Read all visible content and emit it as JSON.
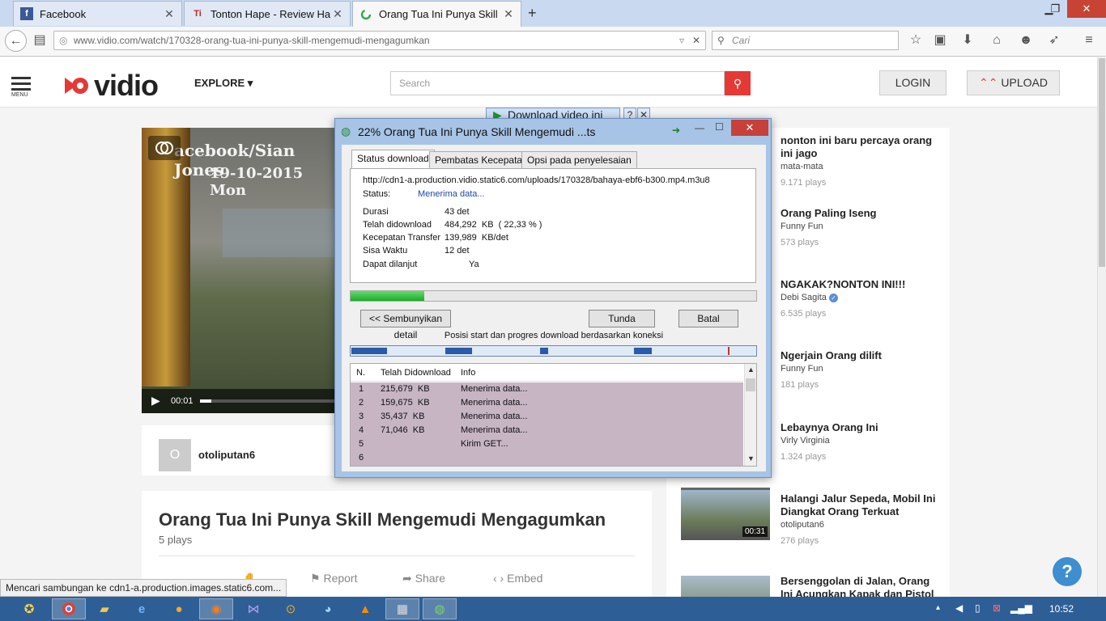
{
  "browser": {
    "tabs": [
      {
        "label": "Facebook",
        "icon": "facebook-icon"
      },
      {
        "label": "Tonton Hape - Review Han...",
        "icon": "tontonhape-icon"
      },
      {
        "label": "Orang Tua Ini Punya Skill ...",
        "icon": "loading-icon"
      }
    ],
    "url": "www.vidio.com/watch/170328-orang-tua-ini-punya-skill-mengemudi-mengagumkan",
    "search_placeholder": "Cari",
    "status_message": "Mencari sambungan ke cdn1-a.production.images.static6.com..."
  },
  "site": {
    "menu_label": "MENU",
    "logo": "vidio",
    "explore": "EXPLORE",
    "search_placeholder": "Search",
    "login": "LOGIN",
    "upload": "UPLOAD",
    "accent": "#e53935"
  },
  "video": {
    "overlay_line1": "acebook/Sian Jones",
    "overlay_line2": "19-10-2015 Mon",
    "time": "00:01",
    "uploader_initial": "O",
    "uploader": "otoliputan6",
    "title": "Orang Tua Ini Punya Skill Mengemudi Mengagumkan",
    "plays": "5 plays",
    "actions": {
      "report": "Report",
      "share": "Share",
      "embed": "Embed"
    }
  },
  "sidebar": [
    {
      "title": "nonton ini baru percaya orang ini jago",
      "channel": "mata-mata",
      "plays": "9.171 plays"
    },
    {
      "title": "Orang Paling Iseng",
      "channel": "Funny Fun",
      "plays": "573 plays"
    },
    {
      "title": "NGAKAK?NONTON INI!!!",
      "channel": "Debi Sagita",
      "plays": "6.535 plays"
    },
    {
      "title": "Ngerjain Orang dilift",
      "channel": "Funny Fun",
      "plays": "181 plays"
    },
    {
      "title": "Lebaynya Orang Ini",
      "channel": "Virly Virginia",
      "plays": "1.324 plays"
    },
    {
      "title": "Halangi Jalur Sepeda, Mobil Ini Diangkat Orang Terkuat",
      "channel": "otoliputan6",
      "plays": "276 plays",
      "duration": "00:31"
    },
    {
      "title": "Bersenggolan di Jalan, Orang Ini Acungkan Kapak dan Pistol",
      "channel": "",
      "plays": ""
    }
  ],
  "download_button": "Download video ini",
  "dialog": {
    "title": "22% Orang Tua Ini Punya Skill Mengemudi ...ts",
    "tabs": [
      "Status download",
      "Pembatas Kecepatan",
      "Opsi pada penyelesaian"
    ],
    "url": "http://cdn1-a.production.vidio.static6.com/uploads/170328/bahaya-ebf6-b300.mp4.m3u8",
    "status_label": "Status:",
    "status_value": "Menerima data...",
    "fields": [
      {
        "label": "Durasi",
        "value": "43 det"
      },
      {
        "label": "Telah didownload",
        "value": "484,292  KB  ( 22,33 % )"
      },
      {
        "label": "Kecepatan Transfer",
        "value": "139,989  KB/det"
      },
      {
        "label": "Sisa Waktu",
        "value": "12 det"
      },
      {
        "label": "Dapat dilanjut",
        "value": "Ya"
      }
    ],
    "progress": 0.1807,
    "hide_details": "<< Sembunyikan detail",
    "pause": "Tunda",
    "cancel": "Batal",
    "segments_caption": "Posisi start dan progres download berdasarkan koneksi",
    "list_headers": [
      "N.",
      "Telah Didownload",
      "Info"
    ],
    "rows": [
      {
        "n": "1",
        "size": "215,679  KB",
        "info": "Menerima data..."
      },
      {
        "n": "2",
        "size": "159,675  KB",
        "info": "Menerima data..."
      },
      {
        "n": "3",
        "size": "35,437  KB",
        "info": "Menerima data..."
      },
      {
        "n": "4",
        "size": "71,046  KB",
        "info": "Menerima data..."
      },
      {
        "n": "5",
        "size": "",
        "info": "Kirim GET..."
      },
      {
        "n": "6",
        "size": "",
        "info": ""
      }
    ]
  },
  "taskbar": {
    "clock": "10:52"
  }
}
